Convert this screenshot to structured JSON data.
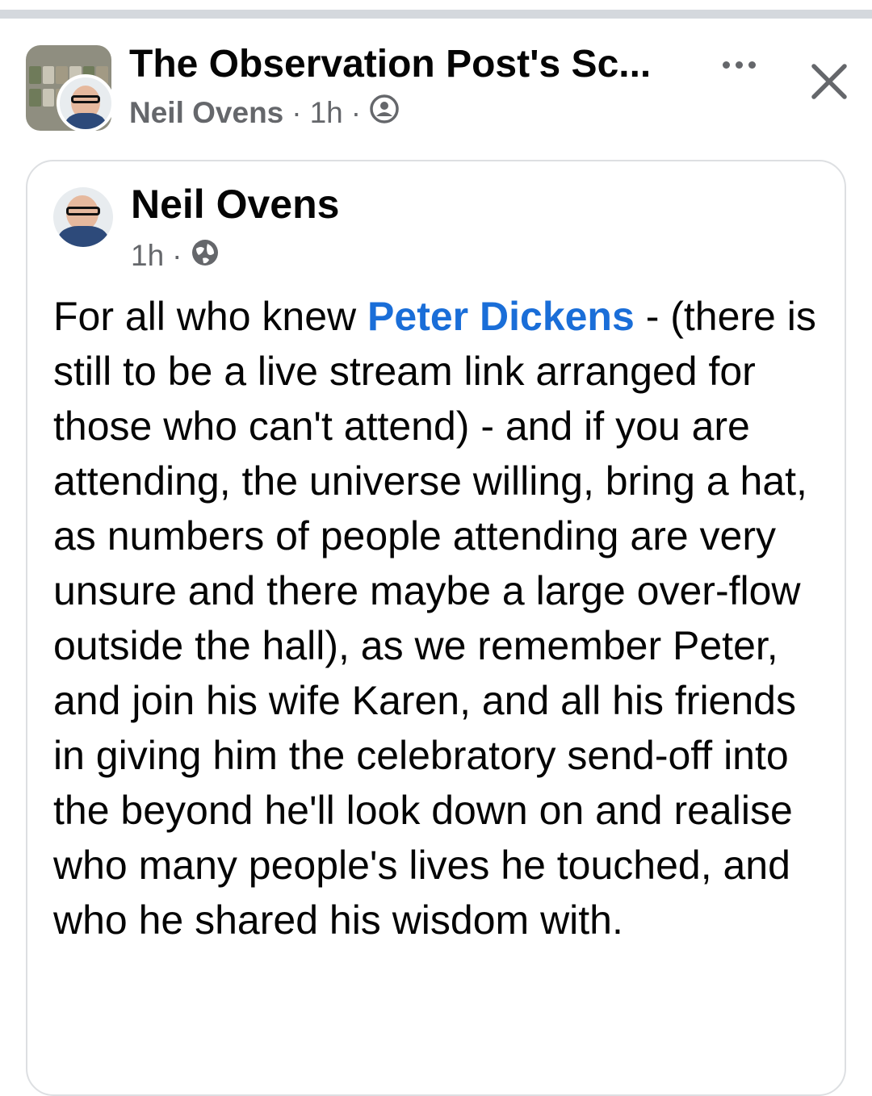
{
  "header": {
    "group_title": "The Observation Post's Sc...",
    "author": "Neil Ovens",
    "time": "1h",
    "separator": "·",
    "privacy_icon": "group-members-icon"
  },
  "controls": {
    "more_icon": "more-dots-icon",
    "close_icon": "close-icon"
  },
  "post": {
    "author": "Neil Ovens",
    "time": "1h",
    "separator": "·",
    "privacy_icon": "globe-icon",
    "body_before": "For all who knew ",
    "mention": "Peter Dickens",
    "body_after": " - (there is still to be a live stream link arranged for those who can't attend) - and if you are attending, the universe willing, bring a hat, as numbers of people attending are very unsure and there maybe a large over-flow outside the hall), as we remember Peter, and join his wife Karen, and all his friends in giving him the celebratory send-off into the beyond he'll look down on and realise who many people's lives he touched, and who he shared his wisdom with."
  },
  "colors": {
    "link": "#1a6ed8",
    "secondary_text": "#65676b",
    "primary_text": "#050505",
    "card_border": "#dddfe2"
  }
}
